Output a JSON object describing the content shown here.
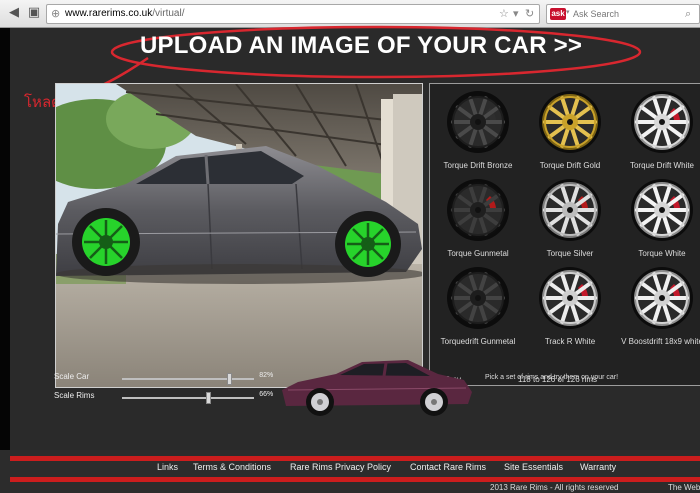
{
  "browser": {
    "url_domain": "www.rarerims.co.uk",
    "url_path": "/virtual/",
    "search_placeholder": "Ask Search"
  },
  "page": {
    "headline": "UPLOAD AN IMAGE OF YOUR CAR >>",
    "annotation": "โหลดรูปรถเรา"
  },
  "rims": [
    {
      "name": "Torque Drift Bronze"
    },
    {
      "name": "Torque Drift Gold"
    },
    {
      "name": "Torque Drift White"
    },
    {
      "name": "Torque Gunmetal"
    },
    {
      "name": "Torque Silver"
    },
    {
      "name": "Torque White"
    },
    {
      "name": "Torquedrift Gunmetal"
    },
    {
      "name": "Track R White"
    },
    {
      "name": "V Boostdrift 18x9 white"
    }
  ],
  "rims_nav": {
    "prev": "<< Prev",
    "count": "118 to 126 of 126 rims"
  },
  "controls": {
    "scale_car": {
      "label": "Scale Car",
      "value": "82",
      "unit": "%",
      "level": 0.82
    },
    "scale_rims": {
      "label": "Scale Rims",
      "value": "66",
      "unit": "%",
      "level": 0.66
    }
  },
  "pick_text": "Pick a set of rims and try them on your car!",
  "footer": {
    "links": [
      "Links",
      "Terms & Conditions",
      "Rare Rims Privacy Policy",
      "Contact Rare Rims",
      "Site Essentials",
      "Warranty"
    ],
    "copyright": "2013  Rare Rims - All rights reserved",
    "right_text": "The Web"
  },
  "colors": {
    "accent_red": "#cc1d1d",
    "annotation_red": "#d8272f",
    "rim_green": "#27d32b",
    "background": "#2a2a2a"
  }
}
